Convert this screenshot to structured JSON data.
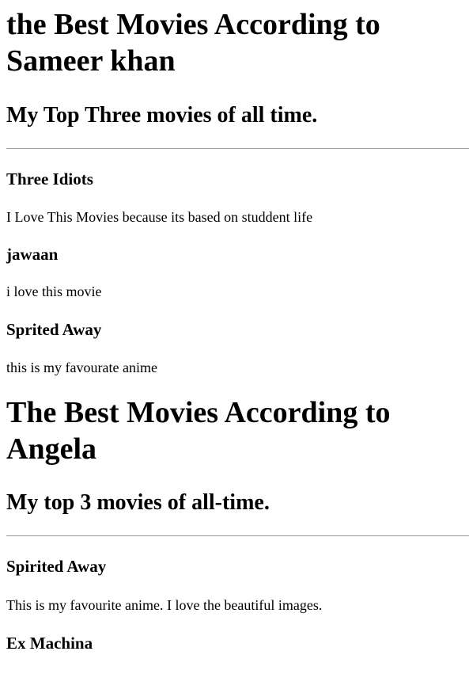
{
  "sections": [
    {
      "title": "the Best Movies According to Sameer khan",
      "subtitle": "My Top Three movies of all time.",
      "movies": [
        {
          "title": "Three Idiots",
          "description": "I Love This Movies because its based on studdent life"
        },
        {
          "title": "jawaan",
          "description": "i love this movie"
        },
        {
          "title": "Sprited Away",
          "description": "this is my favourate anime"
        }
      ]
    },
    {
      "title": "The Best Movies According to Angela",
      "subtitle": "My top 3 movies of all-time.",
      "movies": [
        {
          "title": "Spirited Away",
          "description": "This is my favourite anime. I love the beautiful images."
        },
        {
          "title": "Ex Machina"
        }
      ]
    }
  ]
}
